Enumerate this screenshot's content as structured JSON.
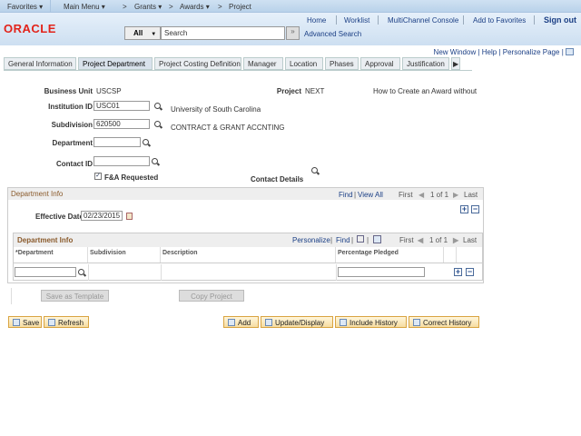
{
  "topnav": {
    "favorites": "Favorites ▾",
    "main_menu": "Main Menu ▾",
    "grants": "Grants ▾",
    "awards": "Awards ▾",
    "project": "Project",
    "sep": ">"
  },
  "header": {
    "home": "Home",
    "worklist": "Worklist",
    "multichannel": "MultiChannel Console",
    "add_favorites": "Add to Favorites",
    "sign_out": "Sign out",
    "logo": "ORACLE",
    "search_scope": "All",
    "search_placeholder": "Search",
    "search_go": "»",
    "advanced_search": "Advanced Search"
  },
  "page_links": {
    "new_window": "New Window",
    "help": "Help",
    "personalize": "Personalize Page"
  },
  "tabs": [
    "General Information",
    "Project Department",
    "Project Costing Definition",
    "Manager",
    "Location",
    "Phases",
    "Approval",
    "Justification"
  ],
  "form": {
    "business_unit_label": "Business Unit",
    "business_unit": "USCSP",
    "project_label": "Project",
    "project": "NEXT",
    "project_desc": "How to Create an Award without",
    "institution_label": "Institution ID",
    "institution": "USC01",
    "institution_desc": "University of South Carolina",
    "subdivision_label": "Subdivision",
    "subdivision": "620500",
    "subdivision_desc": "CONTRACT & GRANT ACCNTING",
    "department_label": "Department",
    "department": "",
    "contact_label": "Contact ID",
    "contact": "",
    "fa_label": "F&A Requested",
    "fa_checked": true,
    "contact_details": "Contact Details"
  },
  "dept_group": {
    "title": "Department Info",
    "find": "Find",
    "view_all": "View All",
    "first": "First",
    "count": "1 of 1",
    "last": "Last",
    "eff_date_label": "Effective Date",
    "eff_date": "02/23/2015"
  },
  "dept_grid": {
    "title": "Department Info",
    "personalize": "Personalize",
    "find": "Find",
    "first": "First",
    "count": "1 of 1",
    "last": "Last",
    "columns": [
      "*Department",
      "Subdivision",
      "Description",
      "Percentage Pledged"
    ]
  },
  "buttons": {
    "save_template": "Save as Template",
    "copy_project": "Copy Project",
    "save": "Save",
    "refresh": "Refresh",
    "add": "Add",
    "update": "Update/Display",
    "include_history": "Include History",
    "correct_history": "Correct History"
  }
}
